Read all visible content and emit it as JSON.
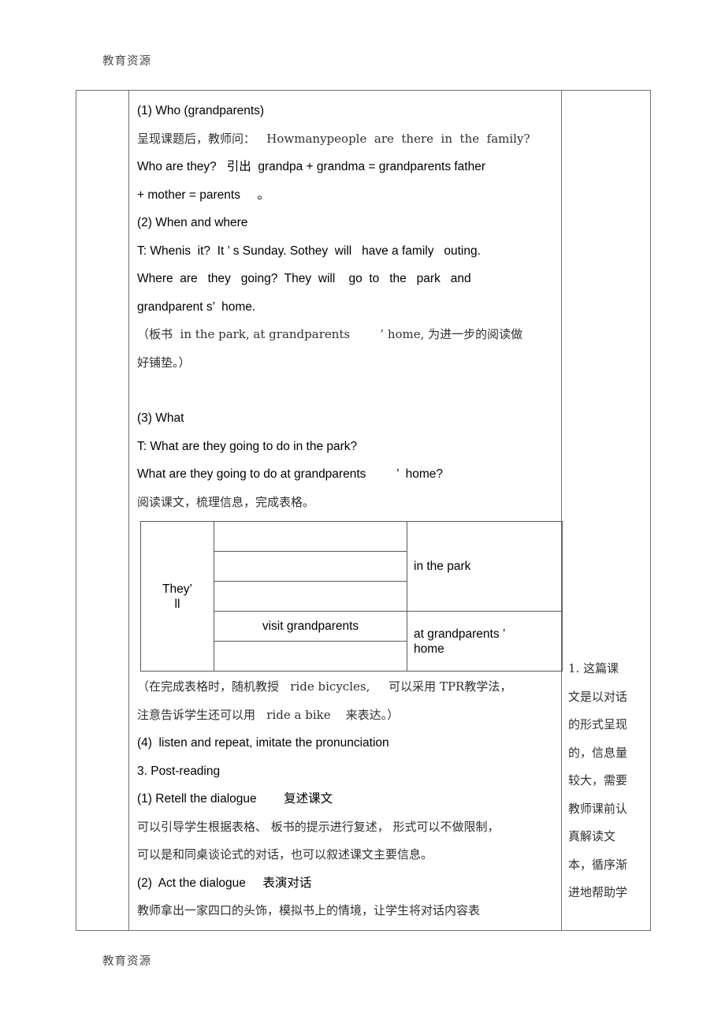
{
  "watermark": {
    "header": "教育资源",
    "footer": "教育资源"
  },
  "document": {
    "left_column": "",
    "body": {
      "paragraphs": [
        {
          "id": "p1",
          "text": "(1) Who (grandparents)"
        },
        {
          "id": "p2",
          "text": "呈现课题后，教师问：   Howmanypeople  are  there  in  the  family?"
        },
        {
          "id": "p3",
          "text": "Who are they?   引出  grandpa + grandma = grandparents father"
        },
        {
          "id": "p4",
          "text": "+ mother = parents     。"
        },
        {
          "id": "p5",
          "text": "(2) When and where"
        },
        {
          "id": "p6",
          "text": "T: Whenis  it?  It ’ s Sunday. Sothey  will   have a family   outing."
        },
        {
          "id": "p7",
          "text": "Where  are   they   going?  They  will    go  to   the   park   and"
        },
        {
          "id": "p8",
          "text": "grandparent s’  home."
        },
        {
          "id": "p9",
          "text": "（板书  in the park, at grandparents        ’ home, 为进一步的阅读做"
        },
        {
          "id": "p10",
          "text": "好铺垫。）"
        },
        {
          "id": "p11",
          "text": "(3) What"
        },
        {
          "id": "p12",
          "text": "T: What are they going to do in the park?"
        },
        {
          "id": "p13",
          "text": "What are they going to do at grandparents         ’  home?"
        },
        {
          "id": "p14",
          "text": "阅读课文，梳理信息，完成表格。"
        },
        {
          "id": "p15",
          "text": "（在完成表格时，随机教授   ride bicycles,     可以采用 TPR教学法，"
        },
        {
          "id": "p16",
          "text": "注意告诉学生还可以用   ride a bike    来表达。）"
        },
        {
          "id": "p17",
          "text": "(4)  listen and repeat, imitate the pronunciation"
        },
        {
          "id": "p18",
          "text": "3. Post-reading"
        },
        {
          "id": "p19",
          "text": "(1) Retell the dialogue        复述课文"
        },
        {
          "id": "p20",
          "text": "可以引导学生根据表格、 板书的提示进行复述， 形式可以不做限制，"
        },
        {
          "id": "p21",
          "text": "可以是和同桌谈论式的对话，也可以叙述课文主要信息。"
        },
        {
          "id": "p22",
          "text": "(2)  Act the dialogue     表演对话"
        },
        {
          "id": "p23",
          "text": "教师拿出一家四口的头饰，模拟书上的情境，让学生将对话内容表"
        }
      ],
      "inner_table": {
        "row_label": "They’",
        "row_label_2": "ll",
        "rows": [
          {
            "activity": "",
            "place": ""
          },
          {
            "activity": "",
            "place": ""
          },
          {
            "activity": "",
            "place": ""
          },
          {
            "activity": "visit grandparents",
            "place": ""
          },
          {
            "activity": "",
            "place": ""
          }
        ],
        "place_cells": [
          {
            "text": "in the park",
            "rowspan": 3
          },
          {
            "text": "at    grandparents  ’\nhome",
            "rowspan": 2
          }
        ]
      }
    },
    "side_column": {
      "lines": [
        "1. 这篇课",
        "文是以对话",
        "的形式呈现",
        "的，信息量",
        "较大，需要",
        "教师课前认",
        "真解读文",
        "本，循序渐",
        "进地帮助学"
      ]
    }
  }
}
